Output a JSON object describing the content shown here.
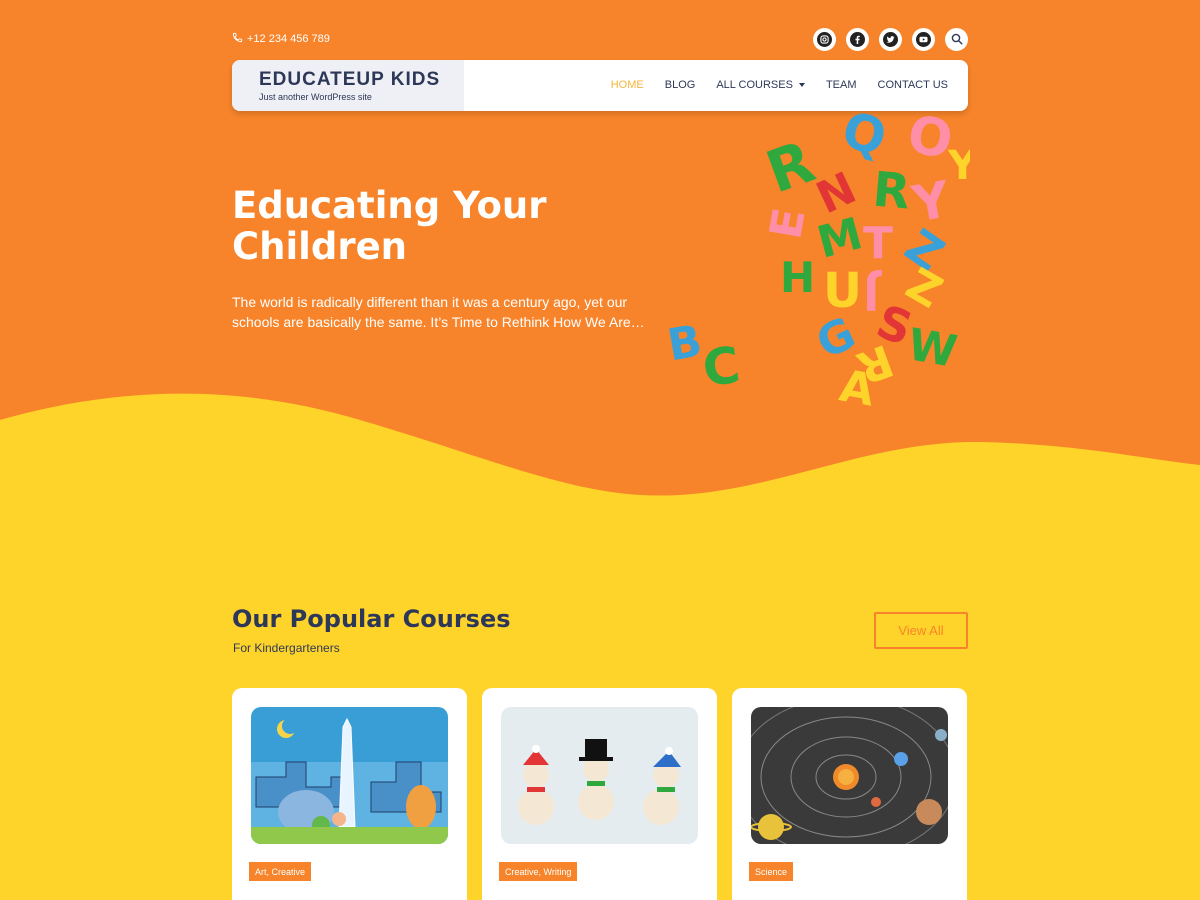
{
  "topbar": {
    "phone": "+12 234 456 789",
    "socials": [
      {
        "icon": "instagram-icon"
      },
      {
        "icon": "facebook-icon"
      },
      {
        "icon": "twitter-icon"
      },
      {
        "icon": "youtube-icon"
      },
      {
        "icon": "search-icon"
      }
    ]
  },
  "brand": {
    "name": "EDUCATEUP KIDS",
    "tagline": "Just another WordPress site"
  },
  "menu": {
    "home": "HOME",
    "blog": "BLOG",
    "courses": "ALL COURSES",
    "team": "TEAM",
    "contact": "CONTACT US"
  },
  "hero": {
    "title_line1": "Educating Your",
    "title_line2": "Children",
    "text": "The world is radically different than it was a century ago, yet our schools are basically the same. It’s Time to Rethink How We Are…"
  },
  "courses": {
    "title": "Our Popular Courses",
    "subtitle": "For Kindergarteners",
    "view_all": "View All",
    "cards": [
      {
        "tag": "Art, Creative"
      },
      {
        "tag": "Creative, Writing"
      },
      {
        "tag": "Science"
      }
    ]
  },
  "colors": {
    "hero_bg": "#f7842a",
    "section_bg": "#ffd42a",
    "heading": "#2d3858",
    "accent": "#f7842a",
    "active_menu": "#f6b53a"
  }
}
